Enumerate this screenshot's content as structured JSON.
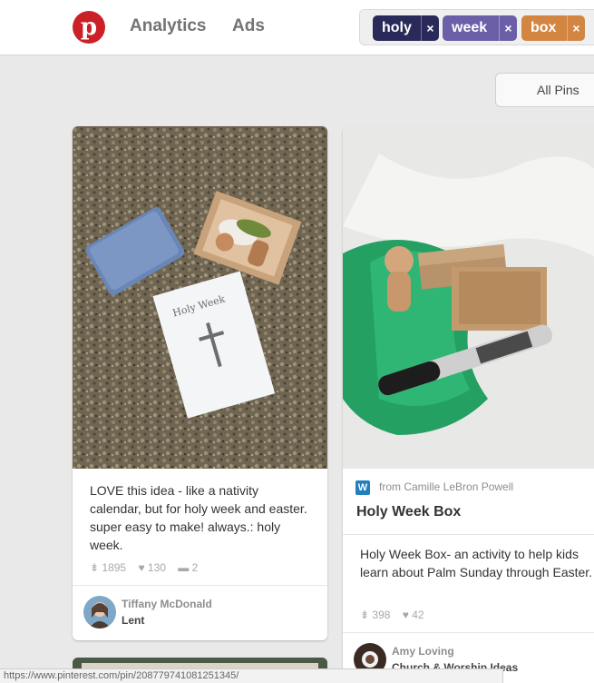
{
  "header": {
    "logo_letter": "p",
    "nav": {
      "analytics": "Analytics",
      "ads": "Ads"
    },
    "search_tokens": [
      {
        "label": "holy",
        "remove": "×"
      },
      {
        "label": "week",
        "remove": "×"
      },
      {
        "label": "box",
        "remove": "×"
      }
    ]
  },
  "filter": {
    "label": "All Pins"
  },
  "pins": [
    {
      "image_text": "Holy Week",
      "description": "LOVE this idea - like a nativity calendar, but for holy week and easter. super easy to make! always.: holy week.",
      "repins": "1895",
      "likes": "130",
      "comments": "2",
      "user": "Tiffany McDonald",
      "board": "Lent"
    },
    {
      "source": "from Camille LeBron Powell",
      "title": "Holy Week Box",
      "description": "Holy Week Box- an activity to help kids learn about Palm Sunday through Easter.",
      "repins": "398",
      "likes": "42",
      "user": "Amy Loving",
      "board": "Church & Worship Ideas"
    }
  ],
  "statusbar": {
    "url": "https://www.pinterest.com/pin/208779741081251345/"
  }
}
